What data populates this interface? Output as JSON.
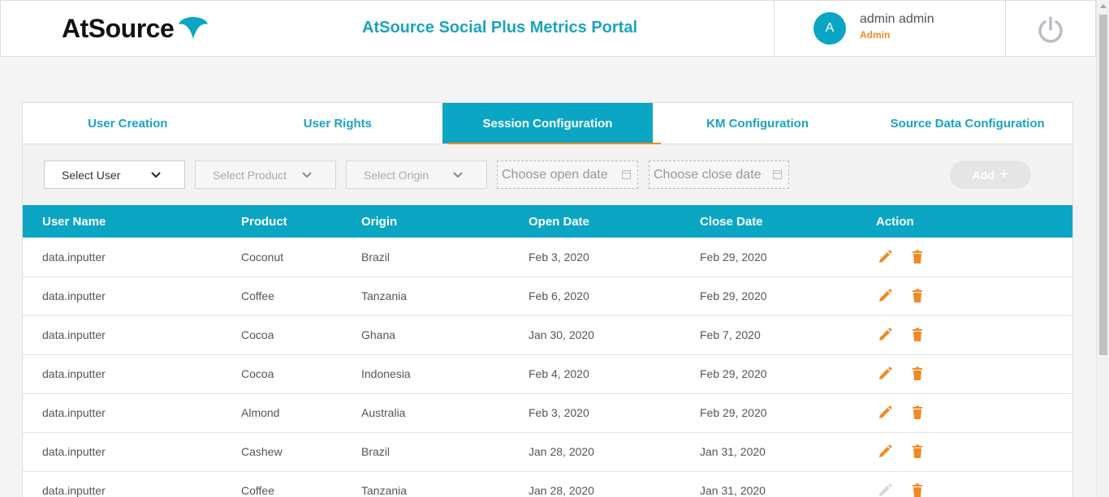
{
  "header": {
    "logo_text": "AtSource",
    "portal_title": "AtSource Social Plus Metrics Portal",
    "avatar_initial": "A",
    "user_name": "admin admin",
    "user_role": "Admin"
  },
  "tabs": [
    {
      "label": "User Creation",
      "active": false
    },
    {
      "label": "User Rights",
      "active": false
    },
    {
      "label": "Session Configuration",
      "active": true
    },
    {
      "label": "KM Configuration",
      "active": false
    },
    {
      "label": "Source Data Configuration",
      "active": false
    }
  ],
  "filters": {
    "user": "Select User",
    "product": "Select Product",
    "origin": "Select Origin",
    "open_date_placeholder": "Choose open date",
    "close_date_placeholder": "Choose close date",
    "add_label": "Add"
  },
  "table": {
    "headers": [
      "User Name",
      "Product",
      "Origin",
      "Open Date",
      "Close Date",
      "Action"
    ],
    "rows": [
      {
        "user": "data.inputter",
        "product": "Coconut",
        "origin": "Brazil",
        "open": "Feb 3, 2020",
        "close": "Feb 29, 2020",
        "edit_enabled": true
      },
      {
        "user": "data.inputter",
        "product": "Coffee",
        "origin": "Tanzania",
        "open": "Feb 6, 2020",
        "close": "Feb 29, 2020",
        "edit_enabled": true
      },
      {
        "user": "data.inputter",
        "product": "Cocoa",
        "origin": "Ghana",
        "open": "Jan 30, 2020",
        "close": "Feb 7, 2020",
        "edit_enabled": true
      },
      {
        "user": "data.inputter",
        "product": "Cocoa",
        "origin": "Indonesia",
        "open": "Feb 4, 2020",
        "close": "Feb 29, 2020",
        "edit_enabled": true
      },
      {
        "user": "data.inputter",
        "product": "Almond",
        "origin": "Australia",
        "open": "Feb 3, 2020",
        "close": "Feb 29, 2020",
        "edit_enabled": true
      },
      {
        "user": "data.inputter",
        "product": "Cashew",
        "origin": "Brazil",
        "open": "Jan 28, 2020",
        "close": "Jan 31, 2020",
        "edit_enabled": true
      },
      {
        "user": "data.inputter",
        "product": "Coffee",
        "origin": "Tanzania",
        "open": "Jan 28, 2020",
        "close": "Jan 31, 2020",
        "edit_enabled": false
      }
    ]
  },
  "colors": {
    "accent": "#0aa6c4",
    "orange": "#f08a24"
  },
  "icons": {
    "edit": "pencil-icon",
    "delete": "trash-icon",
    "power": "power-icon",
    "dropdown": "chevron-down-icon",
    "calendar": "calendar-icon"
  }
}
